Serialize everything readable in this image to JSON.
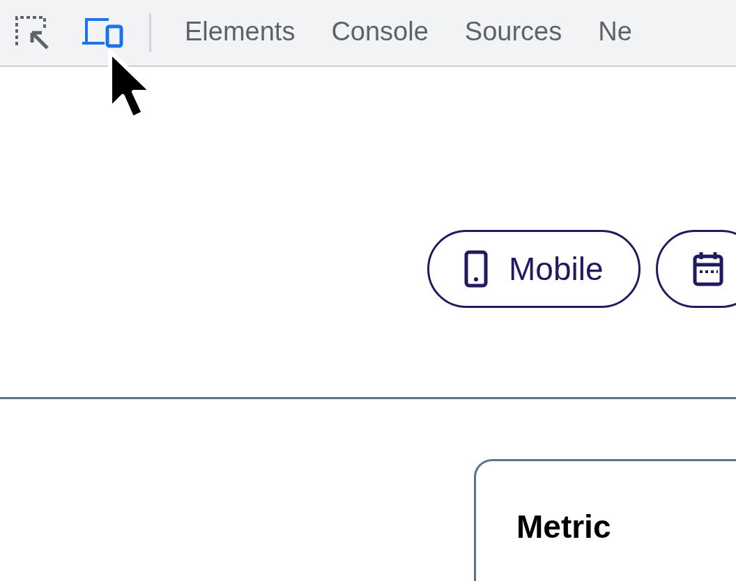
{
  "toolbar": {
    "device_toggle": {
      "on": true
    },
    "tabs": [
      {
        "label": "Elements",
        "selected": false
      },
      {
        "label": "Console",
        "selected": false
      },
      {
        "label": "Sources",
        "selected": false
      },
      {
        "label": "Ne",
        "selected": false
      }
    ]
  },
  "view_buttons": [
    {
      "kind": "mobile",
      "label": "Mobile"
    },
    {
      "kind": "calendar"
    }
  ],
  "card": {
    "title": "Metric"
  }
}
